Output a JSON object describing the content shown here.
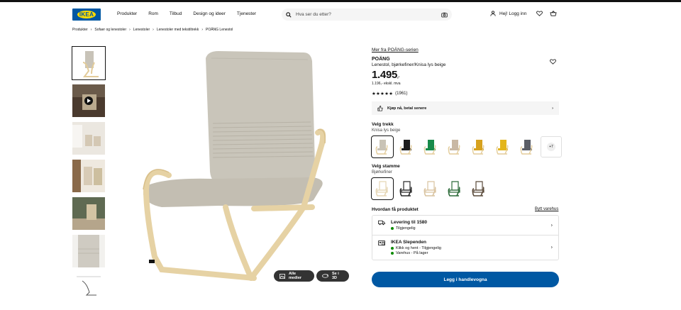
{
  "header": {
    "logo_text": "IKEA",
    "nav": [
      "Produkter",
      "Rom",
      "Tilbud",
      "Design og ideer",
      "Tjenester"
    ],
    "search_placeholder": "Hva ser du etter?",
    "login_label": "Hej! Logg inn"
  },
  "breadcrumb": [
    "Produkter",
    "Sofaer og lenestoler",
    "Lenestoler",
    "Lenestoler med tekstiltrekk",
    "POÄNG Lenestol"
  ],
  "gallery": {
    "thumbs": [
      "chair-front",
      "video",
      "room-1",
      "room-2",
      "room-3",
      "cushion-detail",
      "dimensions"
    ],
    "all_media_label": "Alle medier",
    "view_3d_label": "Se i 3D"
  },
  "product": {
    "series_link": "Mer fra POÄNG-serien",
    "name": "POÄNG",
    "description": "Lenestol, bjørkefiner/Knisa lys beige",
    "price": "1.495",
    "price_suffix": ",-",
    "price_ex_vat": "1.196,- ekskl. mva",
    "rating_stars": "★★★★★",
    "rating_value": 4.5,
    "rating_count": "(1961)",
    "klarna_text": "Kjøp nå, betal senere"
  },
  "cover": {
    "title": "Velg trekk",
    "selected": "Knisa lys beige",
    "colors": [
      "#c9c3b6",
      "#1c1c1c",
      "#178a4a",
      "#c9b8a4",
      "#d7a21e",
      "#e3b51a",
      "#5b5e66"
    ],
    "more_label": "+7"
  },
  "frame": {
    "title": "Velg stamme",
    "selected": "Bjørkefiner",
    "colors": [
      "#e5d6b5",
      "#2a2a2a",
      "#d9c3a0",
      "#2d6b3a",
      "#5a4a3a"
    ]
  },
  "delivery": {
    "title": "Hvordan få produktet",
    "change_store": "Bytt varehus",
    "shipping_title": "Levering til 1580",
    "shipping_status": "Tilgjengelig",
    "store_title": "IKEA Slependen",
    "store_line1": "Klikk og hent - Tilgjengelig",
    "store_line2": "Varehus - På lager"
  },
  "cta_label": "Legg i handlevogna"
}
